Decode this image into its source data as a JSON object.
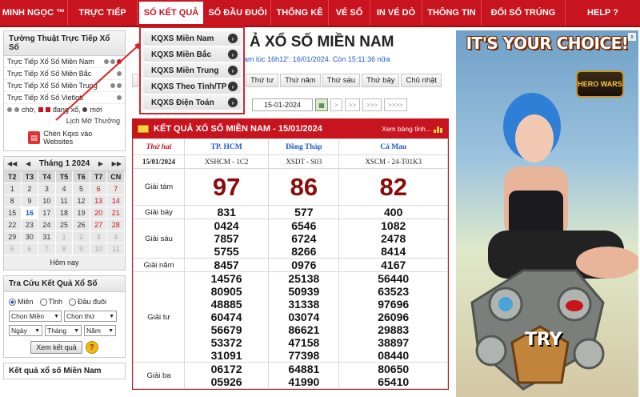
{
  "nav": {
    "items": [
      "MINH NGỌC ™",
      "TRỰC TIẾP",
      "SỔ KẾT QUẢ",
      "SỔ ĐẦU ĐUÔI",
      "THỐNG KÊ",
      "VÉ SỐ",
      "IN VÉ DÒ",
      "THÔNG TIN",
      "ĐỔI SỐ TRÚNG",
      "HELP ?"
    ],
    "active_index": 2
  },
  "dropdown": {
    "items": [
      "KQXS Miền Nam",
      "KQXS Miền Bắc",
      "KQXS Miền Trung",
      "KQXS Theo Tỉnh/TP",
      "KQXS Điện Toán"
    ]
  },
  "live_box": {
    "title": "Tường Thuật Trực Tiếp Xổ Số",
    "rows": [
      "Trực Tiếp Xổ Số Miền Nam",
      "Trực Tiếp Xổ Số Miền Bắc",
      "Trực Tiếp Xổ Số Miền Trung",
      "Trực Tiếp Xổ Số Vietlott"
    ],
    "legend_wait": "chờ,",
    "legend_running": "đang xổ,",
    "legend_new": "mới",
    "old_link": "Lịch Mở Thưởng",
    "embed_link": "Chèn Kqxs vào Websites"
  },
  "calendar": {
    "month_label": "Tháng 1 2024",
    "dows": [
      "T2",
      "T3",
      "T4",
      "T5",
      "T6",
      "T7",
      "CN"
    ],
    "weeks": [
      [
        "1",
        "2",
        "3",
        "4",
        "5",
        "6",
        "7"
      ],
      [
        "8",
        "9",
        "10",
        "11",
        "12",
        "13",
        "14"
      ],
      [
        "15",
        "16",
        "17",
        "18",
        "19",
        "20",
        "21"
      ],
      [
        "22",
        "23",
        "24",
        "25",
        "26",
        "27",
        "28"
      ],
      [
        "29",
        "30",
        "31",
        "1",
        "2",
        "3",
        "4"
      ],
      [
        "5",
        "6",
        "7",
        "8",
        "9",
        "10",
        "11"
      ]
    ],
    "today": "Hôm nay"
  },
  "search": {
    "title": "Tra Cứu Kết Quả Xổ Số",
    "radios": [
      "Miền",
      "Tỉnh",
      "Đầu đuôi"
    ],
    "select_region": "Chọn Miền",
    "select_day": "Chọn thứ",
    "select_date": "Ngày",
    "select_month": "Tháng",
    "select_year": "Năm",
    "button": "Xem kết quả",
    "help": "?"
  },
  "bottom_box": {
    "title": "Kết quả xổ số Miền Nam"
  },
  "main": {
    "title": "Ả XỔ SỐ MIỀN NAM",
    "notice": "am lúc 16h12': 16/01/2024. Còn 15:11:36 nữa",
    "tabs": [
      "Thứ tư",
      "Thứ năm",
      "Thứ sáu",
      "Thứ bảy",
      "Chủ nhật"
    ],
    "date_value": "15-01-2024",
    "nav_buttons": [
      ">",
      ">>",
      ">>>",
      ">>>>"
    ]
  },
  "result": {
    "heading": "KẾT QUẢ XỔ SỐ MIỀN NAM - 15/01/2024",
    "more": "Xem bảng tỉnh...",
    "day": "Thứ hai",
    "date": "15/01/2024",
    "provinces": [
      "TP. HCM",
      "Đồng Tháp",
      "Cà Mau"
    ],
    "codes": [
      "XSHCM - 1C2",
      "XSDT - S03",
      "XSCM - 24-T01K3"
    ],
    "prizes": [
      {
        "label": "Giải tám",
        "values": [
          [
            "97"
          ],
          [
            "86"
          ],
          [
            "82"
          ]
        ]
      },
      {
        "label": "Giải bảy",
        "values": [
          [
            "831"
          ],
          [
            "577"
          ],
          [
            "400"
          ]
        ]
      },
      {
        "label": "Giải sáu",
        "values": [
          [
            "0424",
            "7857",
            "5755"
          ],
          [
            "6546",
            "6724",
            "8266"
          ],
          [
            "1082",
            "2478",
            "8414"
          ]
        ]
      },
      {
        "label": "Giải năm",
        "values": [
          [
            "8457"
          ],
          [
            "0976"
          ],
          [
            "4167"
          ]
        ]
      },
      {
        "label": "Giải tư",
        "values": [
          [
            "14576",
            "80905",
            "48885",
            "60474",
            "56679",
            "53372",
            "31091"
          ],
          [
            "25138",
            "50939",
            "31338",
            "03074",
            "86621",
            "47158",
            "77398"
          ],
          [
            "56440",
            "63523",
            "97696",
            "26096",
            "29883",
            "38897",
            "08440"
          ]
        ]
      },
      {
        "label": "Giải ba",
        "values": [
          [
            "06172",
            "05926"
          ],
          [
            "64881",
            "41990"
          ],
          [
            "80650",
            "65410"
          ]
        ]
      }
    ]
  },
  "ad": {
    "headline": "IT'S YOUR CHOICE!",
    "logo_text": "HERO WARS",
    "cta": "TRY",
    "close": "x"
  },
  "colors": {
    "brand_red": "#c8141e",
    "prize_big": "#8b0a0a",
    "link_blue": "#1a5acb"
  }
}
